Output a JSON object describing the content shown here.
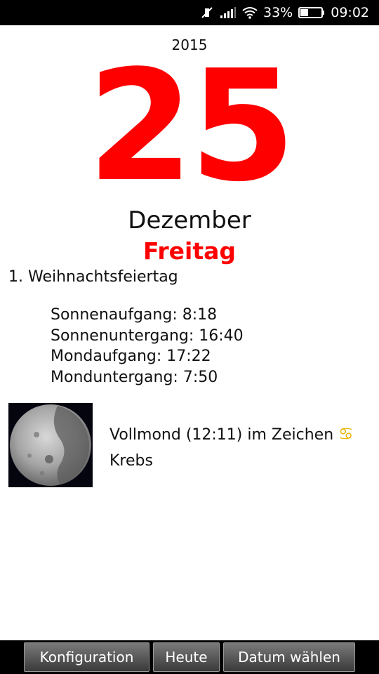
{
  "status_bar": {
    "battery_percent": "33%",
    "time": "09:02",
    "icons": [
      "mute-icon",
      "signal-icon",
      "wifi-icon",
      "battery-icon"
    ]
  },
  "calendar": {
    "year": "2015",
    "day": "25",
    "month": "Dezember",
    "weekday": "Freitag",
    "holiday": "1. Weihnachtsfeiertag",
    "accent_color": "#ff0000"
  },
  "times": {
    "sunrise": "Sonnenaufgang: 8:18",
    "sunset": "Sonnenuntergang: 16:40",
    "moonrise": "Mondaufgang: 17:22",
    "moonset": "Monduntergang: 7:50"
  },
  "moon": {
    "phase_text": "Vollmond (12:11) im Zeichen",
    "zodiac_symbol": "♋",
    "zodiac_name": "Krebs"
  },
  "buttons": {
    "config": "Konfiguration",
    "today": "Heute",
    "choose_date": "Datum wählen"
  }
}
